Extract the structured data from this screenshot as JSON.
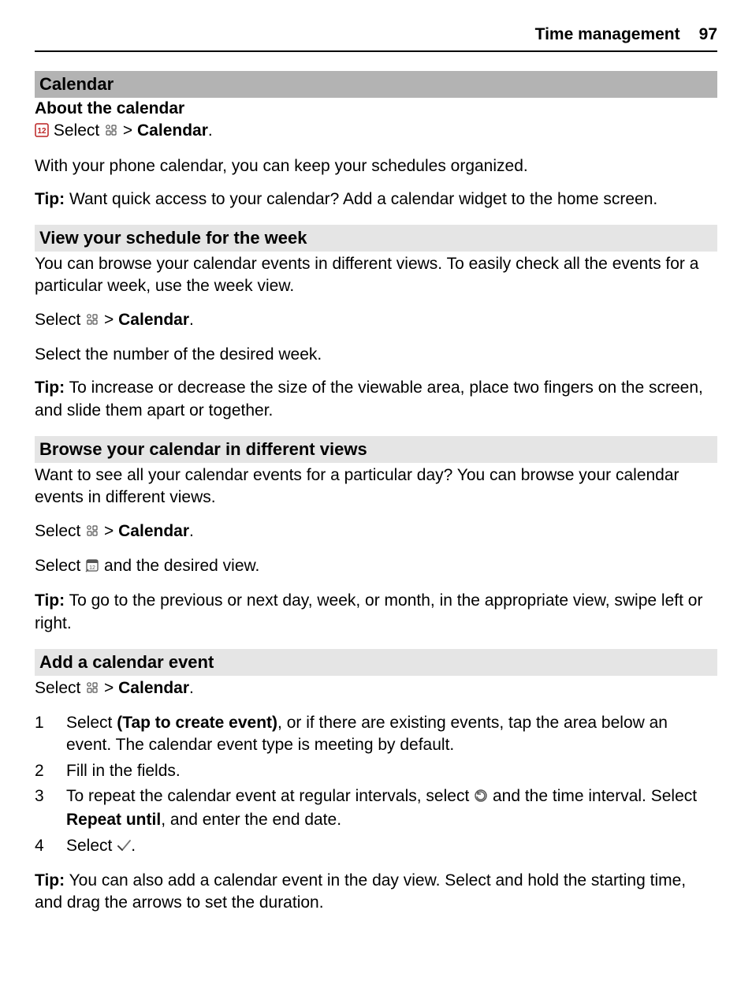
{
  "header": {
    "title": "Time management",
    "page": "97"
  },
  "section_bar": "Calendar",
  "s1": {
    "title": "About the calendar",
    "select_prefix": "Select",
    "gt": " > ",
    "calendar_label": "Calendar",
    "period": ".",
    "intro": "With your phone calendar, you can keep your schedules organized.",
    "tip_label": "Tip:",
    "tip_text": " Want quick access to your calendar? Add a calendar widget to the home screen."
  },
  "s2": {
    "title": "View your schedule for the week",
    "intro": "You can browse your calendar events in different views. To easily check all the events for a particular week, use the week view.",
    "select_line_prefix": "Select ",
    "gt": " > ",
    "calendar_label": "Calendar",
    "period": ".",
    "select_week": "Select the number of the desired week.",
    "tip_label": "Tip:",
    "tip_text": " To increase or decrease the size of the viewable area, place two fingers on the screen, and slide them apart or together."
  },
  "s3": {
    "title": "Browse your calendar in different views",
    "intro": "Want to see all your calendar events for a particular day? You can browse your calendar events in different views.",
    "select_line_prefix": "Select ",
    "gt": " > ",
    "calendar_label": "Calendar",
    "period": ".",
    "select_view_prefix": "Select ",
    "select_view_suffix": " and the desired view.",
    "tip_label": "Tip:",
    "tip_text": " To go to the previous or next day, week, or month, in the appropriate view, swipe left or right."
  },
  "s4": {
    "title": "Add a calendar event",
    "select_line_prefix": "Select ",
    "gt": " > ",
    "calendar_label": "Calendar",
    "period": ".",
    "steps": {
      "n1": "1",
      "t1a": "Select ",
      "t1b": "(Tap to create event)",
      "t1c": ", or if there are existing events, tap the area below an event. The calendar event type is meeting by default.",
      "n2": "2",
      "t2": "Fill in the fields.",
      "n3": "3",
      "t3a": "To repeat the calendar event at regular intervals, select ",
      "t3b": " and the time interval. Select ",
      "t3c": "Repeat until",
      "t3d": ", and enter the end date.",
      "n4": "4",
      "t4a": "Select ",
      "t4b": "."
    },
    "tip_label": "Tip:",
    "tip_text": " You can also add a calendar event in the day view. Select and hold the starting time, and drag the arrows to set the duration."
  }
}
